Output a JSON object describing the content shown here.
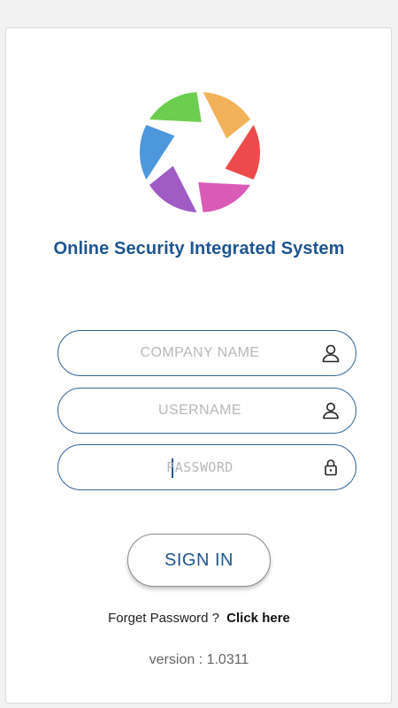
{
  "app": {
    "title": "Online Security Integrated System",
    "logo_icon": "aperture-logo-icon",
    "brand_color": "#1e5590"
  },
  "form": {
    "company": {
      "placeholder": "COMPANY NAME",
      "value": "",
      "icon": "user-icon"
    },
    "username": {
      "placeholder": "USERNAME",
      "value": "",
      "icon": "user-icon"
    },
    "password": {
      "placeholder": "PASSWORD",
      "value": "",
      "icon": "lock-icon"
    },
    "signin_label": "SIGN IN"
  },
  "footer": {
    "forgot_text": "Forget Password ?",
    "forgot_link": "Click here",
    "version": "version : 1.0311"
  },
  "logo_colors": [
    "#6cce4e",
    "#f2b25a",
    "#ed4b4b",
    "#d95bb6",
    "#a05cc4",
    "#4d97dc"
  ]
}
